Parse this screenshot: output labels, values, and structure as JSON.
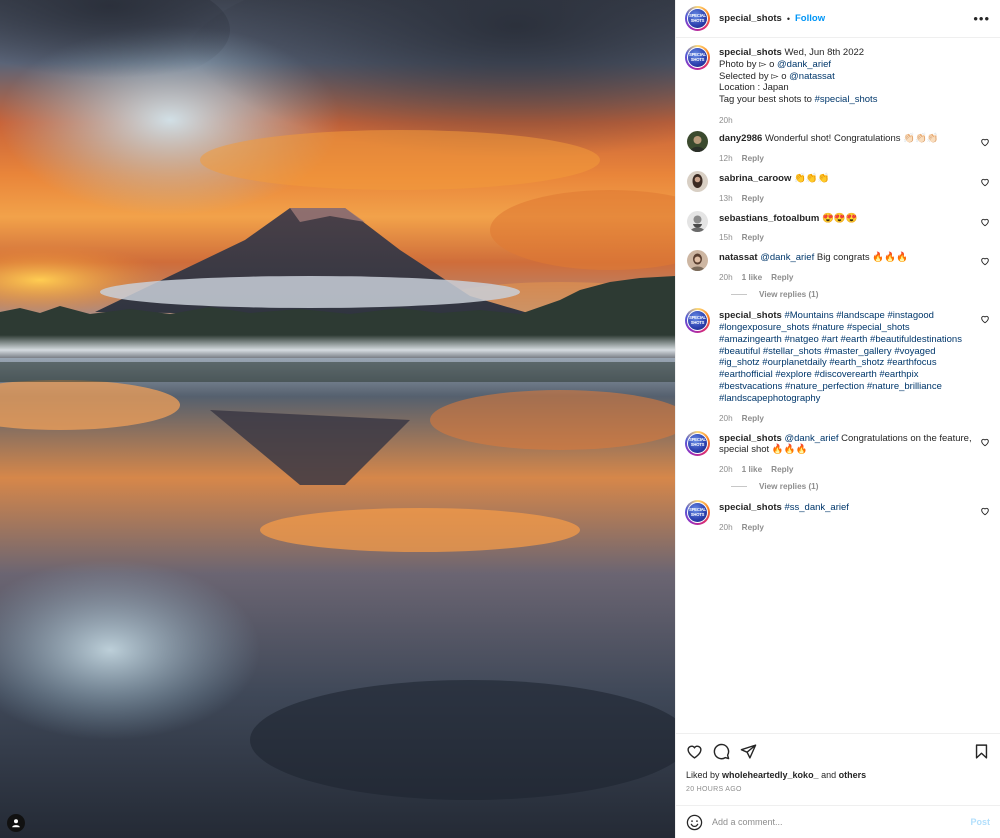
{
  "post": {
    "username": "special_shots",
    "separator": "•",
    "follow_label": "Follow",
    "more_label": "•••",
    "avatar_text_line1": "SPECIAL",
    "avatar_text_line2": "SHOTS"
  },
  "caption": {
    "username": "special_shots",
    "date": "Wed, Jun 8th 2022",
    "line1_prefix": "Photo by ▻ o ",
    "line1_mention": "@dank_arief",
    "line2_prefix": "Selected by ▻ o ",
    "line2_mention": "@natassat",
    "line3": "Location : Japan",
    "line4_prefix": "Tag your best shots to ",
    "line4_tag": "#special_shots",
    "time": "20h"
  },
  "comments": [
    {
      "username": "dany2986",
      "text": "Wonderful shot! Congratulations 👏🏻👏🏻👏🏻",
      "time": "12h",
      "reply": "Reply"
    },
    {
      "username": "sabrina_caroow",
      "text": "👏👏👏",
      "time": "13h",
      "reply": "Reply"
    },
    {
      "username": "sebastians_fotoalbum",
      "text": "😍😍😍",
      "time": "15h",
      "reply": "Reply"
    },
    {
      "username": "natassat",
      "mention": "@dank_arief",
      "text": " Big congrats 🔥🔥🔥",
      "time": "20h",
      "likes": "1 like",
      "reply": "Reply",
      "view_replies": "View replies (1)"
    },
    {
      "username": "special_shots",
      "text": "#Mountains #landscape #instagood #longexposure_shots #nature #special_shots #amazingearth #natgeo #art #earth #beautifuldestinations #beautiful #stellar_shots #master_gallery #voyaged #ig_shotz #ourplanetdaily #earth_shotz #earthfocus #earthofficial #explore #discoverearth #earthpix #bestvacations #nature_perfection #nature_brilliance #landscapephotography",
      "time": "20h",
      "reply": "Reply"
    },
    {
      "username": "special_shots",
      "mention": "@dank_arief",
      "text": " Congratulations on the feature, special shot 🔥🔥🔥",
      "time": "20h",
      "likes": "1 like",
      "reply": "Reply",
      "view_replies": "View replies (1)"
    },
    {
      "username": "special_shots",
      "mention": "#ss_dank_arief",
      "text": "",
      "time": "20h",
      "reply": "Reply"
    }
  ],
  "likes": {
    "prefix": "Liked by ",
    "user": "wholeheartedly_koko_",
    "middle": " and ",
    "others": "others",
    "ago": "20 HOURS AGO"
  },
  "composer": {
    "placeholder": "Add a comment...",
    "post_label": "Post"
  },
  "colors": {
    "link": "#00376b",
    "follow": "#0095f6",
    "muted": "#8e8e8e"
  }
}
